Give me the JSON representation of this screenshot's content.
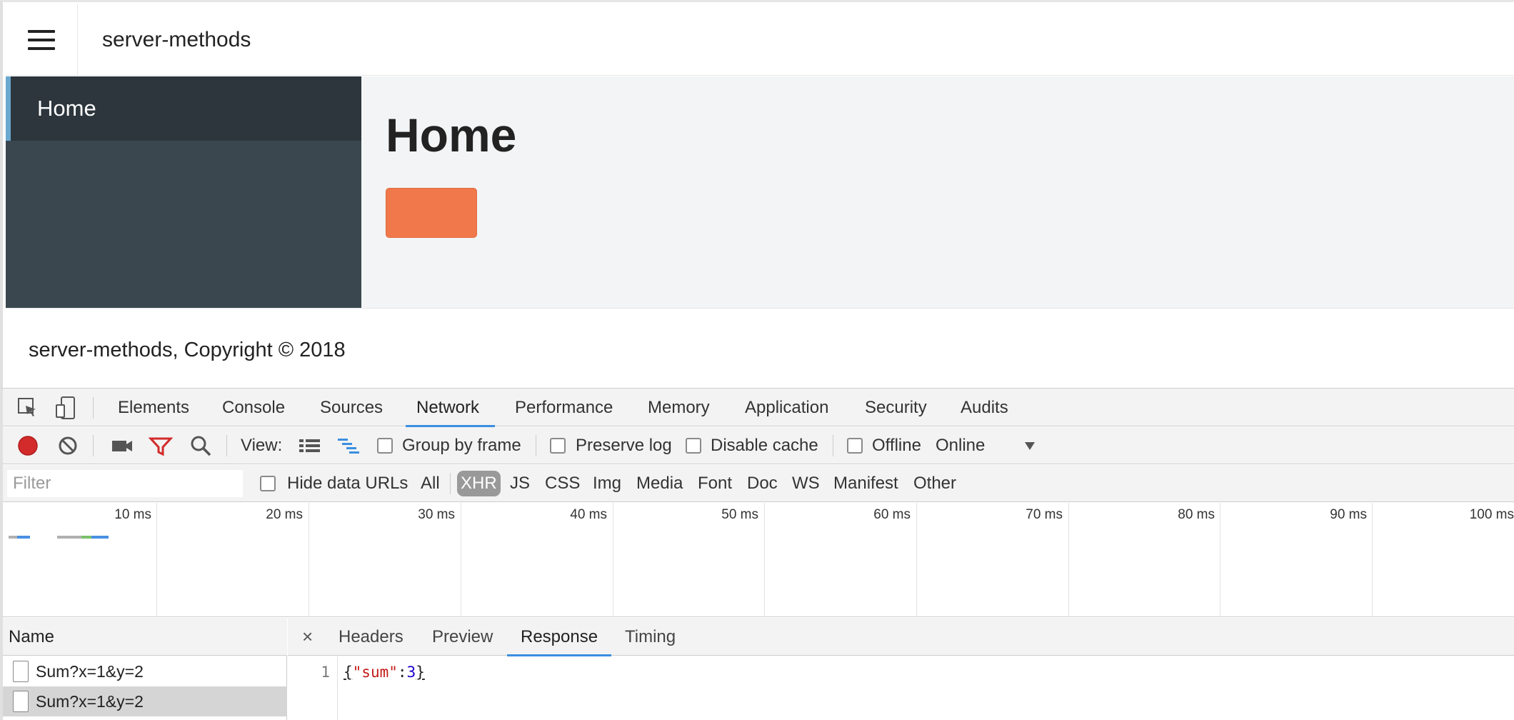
{
  "app": {
    "title": "server-methods",
    "sidebar": {
      "items": [
        {
          "label": "Home"
        }
      ]
    },
    "main": {
      "heading": "Home"
    },
    "footer": {
      "text": "server-methods, Copyright © 2018"
    }
  },
  "devtools": {
    "tabs": [
      "Elements",
      "Console",
      "Sources",
      "Network",
      "Performance",
      "Memory",
      "Application",
      "Security",
      "Audits"
    ],
    "active_tab": "Network",
    "toolbar": {
      "view_label": "View:",
      "group_by_frame": "Group by frame",
      "preserve_log": "Preserve log",
      "disable_cache": "Disable cache",
      "offline": "Offline",
      "throttling": "Online"
    },
    "filter": {
      "placeholder": "Filter",
      "hide_data_urls": "Hide data URLs",
      "types": [
        "All",
        "XHR",
        "JS",
        "CSS",
        "Img",
        "Media",
        "Font",
        "Doc",
        "WS",
        "Manifest",
        "Other"
      ],
      "active_type": "XHR"
    },
    "timeline": {
      "ticks": [
        "10 ms",
        "20 ms",
        "30 ms",
        "40 ms",
        "50 ms",
        "60 ms",
        "70 ms",
        "80 ms",
        "90 ms",
        "100 ms"
      ]
    },
    "requests": {
      "column": "Name",
      "rows": [
        "Sum?x=1&y=2",
        "Sum?x=1&y=2"
      ]
    },
    "detail": {
      "close": "×",
      "tabs": [
        "Headers",
        "Preview",
        "Response",
        "Timing"
      ],
      "active_tab": "Response",
      "line_number": "1",
      "response": {
        "open": "{",
        "key": "\"sum\"",
        "colon": ":",
        "value": "3",
        "close": "}"
      }
    }
  },
  "colors": {
    "accent_orange": "#f0784b",
    "sidebar_bg": "#3b474e",
    "sidebar_active": "#2c363c",
    "devtools_blue": "#3b8fe0",
    "record_red": "#d32b2b"
  }
}
